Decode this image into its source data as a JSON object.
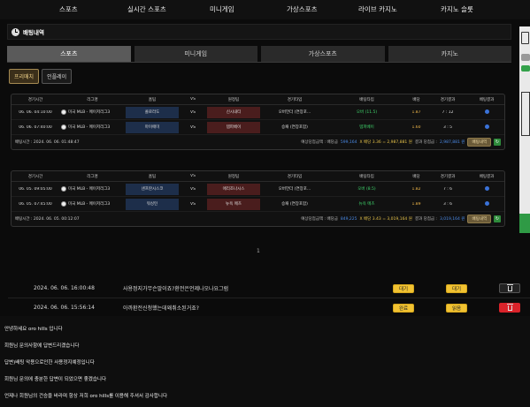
{
  "top_nav": [
    {
      "label": "스포츠"
    },
    {
      "label": "실시간 스포츠"
    },
    {
      "label": "미니게임"
    },
    {
      "label": "가상스포츠"
    },
    {
      "label": "라이브 카지노"
    },
    {
      "label": "카지노 슬롯"
    }
  ],
  "header": {
    "title": "배팅내역"
  },
  "tabs": [
    {
      "label": "스포츠"
    },
    {
      "label": "미니게임"
    },
    {
      "label": "가상스포츠"
    },
    {
      "label": "카지노"
    }
  ],
  "subtabs": [
    {
      "label": "프리매치"
    },
    {
      "label": "인플레이"
    }
  ],
  "columns": [
    "경기시간",
    "리그명",
    "홈팀",
    "VS",
    "원정팀",
    "경기타입",
    "배팅타입",
    "배당",
    "경기결과",
    "배팅결과"
  ],
  "bets": [
    {
      "rows": [
        {
          "time": "06. 06. 04:10:00",
          "league": "미국 MLB - 메이저리그3",
          "home": "콜로라도",
          "vs": "VS",
          "away": "신시내티",
          "type": "오버언더 (연장포...",
          "pick": "오버 (11.5)",
          "odds": "1.87",
          "score": "7 : 12"
        },
        {
          "time": "06. 06. 07:40:00",
          "league": "미국 MLB - 메이저리그3",
          "home": "마이애미",
          "vs": "VS",
          "away": "템파베이",
          "type": "승패 (연장포함)",
          "pick": "템파베이",
          "odds": "1.60",
          "score": "3 : 5"
        }
      ],
      "footer_left": "배팅시간 : 2024. 06. 06. 01:48:47",
      "footer_amount_label": "예상당첨금액 : 배당금",
      "footer_amount": "599,164",
      "footer_mult": "X 배당 3.36 = 2,987,881 원",
      "footer_result_label": "결과 당첨금 :",
      "footer_result": "2,987,881 원",
      "button": "배팅내역"
    },
    {
      "rows": [
        {
          "time": "06. 05. 09:05:00",
          "league": "미국 MLB - 메이저리그3",
          "home": "샌프란시스코",
          "vs": "VS",
          "away": "애리조나시스",
          "type": "오버언더 (연장포...",
          "pick": "오버 (8.5)",
          "odds": "1.82",
          "score": "7 : 6"
        },
        {
          "time": "06. 05. 07:45:00",
          "league": "미국 MLB - 메이저리그3",
          "home": "워싱턴",
          "vs": "VS",
          "away": "뉴욕 메츠",
          "type": "승패 (연장포함)",
          "pick": "뉴욕 메츠",
          "odds": "1.89",
          "score": "3 : 6"
        }
      ],
      "footer_left": "배팅시간 : 2024. 06. 05. 00:12:07",
      "footer_amount_label": "예상당첨금액 : 배당금",
      "footer_amount": "849,225",
      "footer_mult": "X 배당 3.43 = 3,019,164 원",
      "footer_result_label": "결과 당첨금 :",
      "footer_result": "3,019,164 원",
      "button": "배팅내역"
    }
  ],
  "pager": {
    "current": "1"
  },
  "inquiries": [
    {
      "date": "2024. 06. 06. 16:00:48",
      "title": "사용정지가무슨말이죠?환전은언제나오나요그럼",
      "status": "대기",
      "answer": "대기"
    },
    {
      "date": "2024. 06. 06. 15:56:14",
      "title": "아까환전신청했는데왜취소된거죠?",
      "status": "완료",
      "answer": "읽음"
    }
  ],
  "answer_lines": [
    "안녕하세요 oro hills 입니다",
    "회원님 문의사항에 답변드리겠습니다",
    "답변)배팅 악용으로인한 사용정지예정입니다",
    "회원님 문의에 충분한 답변이 되었으면 좋겠습니다",
    "언제나 회원님의 건승을 바라며 항상 저희 oro hills를 이용해 주셔서 감사합니다"
  ],
  "colors": {
    "accent_gold": "#a58a52",
    "badge_yellow": "#f1c232",
    "delete_red": "#d9232a",
    "odds": "#f0b84a",
    "pick_green": "#3fd36b",
    "result_blue": "#3a72d8"
  },
  "icons": [
    "clock-icon",
    "trash-icon",
    "flag-icon",
    "refresh-icon"
  ]
}
